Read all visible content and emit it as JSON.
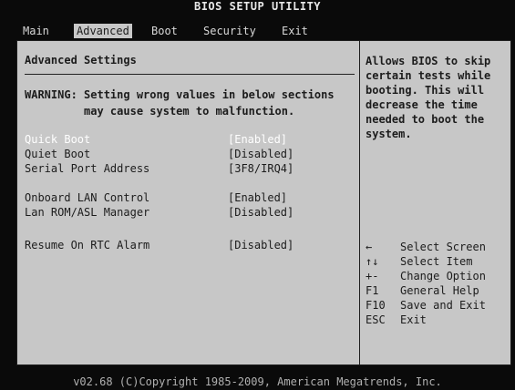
{
  "title": "BIOS SETUP UTILITY",
  "menu": [
    {
      "label": "Main"
    },
    {
      "label": "Advanced"
    },
    {
      "label": "Boot"
    },
    {
      "label": "Security"
    },
    {
      "label": "Exit"
    }
  ],
  "main": {
    "heading": "Advanced Settings",
    "warning_line1": "WARNING: Setting wrong values in below sections",
    "warning_line2": "         may cause system to malfunction.",
    "rows": [
      {
        "label": "Quick Boot",
        "value": "[Enabled]"
      },
      {
        "label": "Quiet Boot",
        "value": "[Disabled]"
      },
      {
        "label": "Serial Port Address",
        "value": "[3F8/IRQ4]"
      },
      {
        "label": "Onboard LAN Control",
        "value": "[Enabled]"
      },
      {
        "label": "Lan ROM/ASL Manager",
        "value": "[Disabled]"
      },
      {
        "label": "Resume On RTC Alarm",
        "value": "[Disabled]"
      }
    ]
  },
  "help": {
    "text": "Allows BIOS to skip certain tests while booting. This will decrease the time needed to boot the system."
  },
  "keys": [
    {
      "key": "←",
      "desc": "Select Screen"
    },
    {
      "key": "↑↓",
      "desc": "Select Item"
    },
    {
      "key": "+-",
      "desc": "Change Option"
    },
    {
      "key": "F1",
      "desc": "General Help"
    },
    {
      "key": "F10",
      "desc": "Save and Exit"
    },
    {
      "key": "ESC",
      "desc": "Exit"
    }
  ],
  "footer": "v02.68 (C)Copyright 1985-2009, American Megatrends, Inc."
}
